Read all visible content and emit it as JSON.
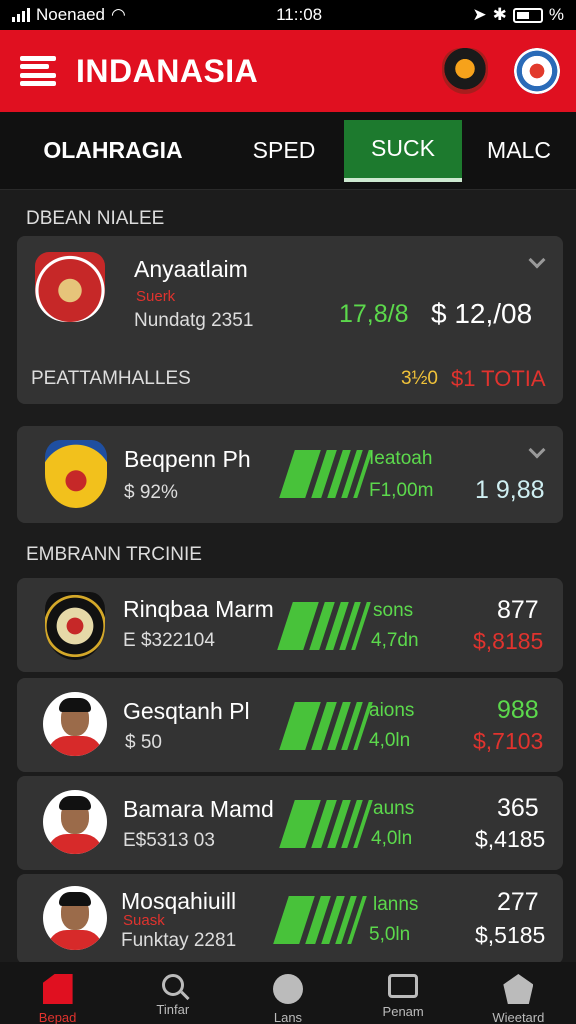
{
  "status_bar": {
    "carrier": "Noenaed",
    "time": "11::08",
    "battery": "%"
  },
  "app": {
    "title": "INDANASIA"
  },
  "tabs": [
    {
      "label": "OLAHRAGIA"
    },
    {
      "label": "SPED"
    },
    {
      "label": "SUCK"
    },
    {
      "label": "MALC"
    }
  ],
  "sections": {
    "first": "DBEAN NIALEE",
    "second": "EMBRANN TRCINIE"
  },
  "matches": [
    {
      "name": "Anyaatlaim",
      "tag": "Suerk",
      "sub": "Nundatg 2351",
      "value": "17,8/8",
      "price": "$ 12,/08",
      "footer_label": "PEATTAMHALLES",
      "footer_a": "3½0",
      "footer_b": "$1 TOTIA"
    },
    {
      "name": "Beqpenn Ph",
      "sub": "$ 92%",
      "label_a": "Ieatoah",
      "label_b": "F1,00m",
      "value": "1 9,88"
    }
  ],
  "players": [
    {
      "name": "Rinqbaa Marm",
      "sub": "E $322104",
      "label_a": "sons",
      "label_b": "4,7dn",
      "score": "877",
      "price": "$,8185"
    },
    {
      "name": "Gesqtanh Pl",
      "sub": "$ 50",
      "label_a": "aions",
      "label_b": "4,0ln",
      "score": "988",
      "price": "$,7103"
    },
    {
      "name": "Bamara Mamd",
      "sub": "E$5313 03",
      "label_a": "auns",
      "label_b": "4,0ln",
      "score": "365",
      "price": "$,4185"
    },
    {
      "name": "Mosqahiuill",
      "tag": "Suask",
      "sub": "Funktay 2281",
      "label_a": "lanns",
      "label_b": "5,0ln",
      "score": "277",
      "price": "$,5185"
    }
  ],
  "nav": [
    {
      "label": "Bepad"
    },
    {
      "label": "Tinfar"
    },
    {
      "label": "Lans"
    },
    {
      "label": "Penam"
    },
    {
      "label": "Wieetard"
    }
  ]
}
